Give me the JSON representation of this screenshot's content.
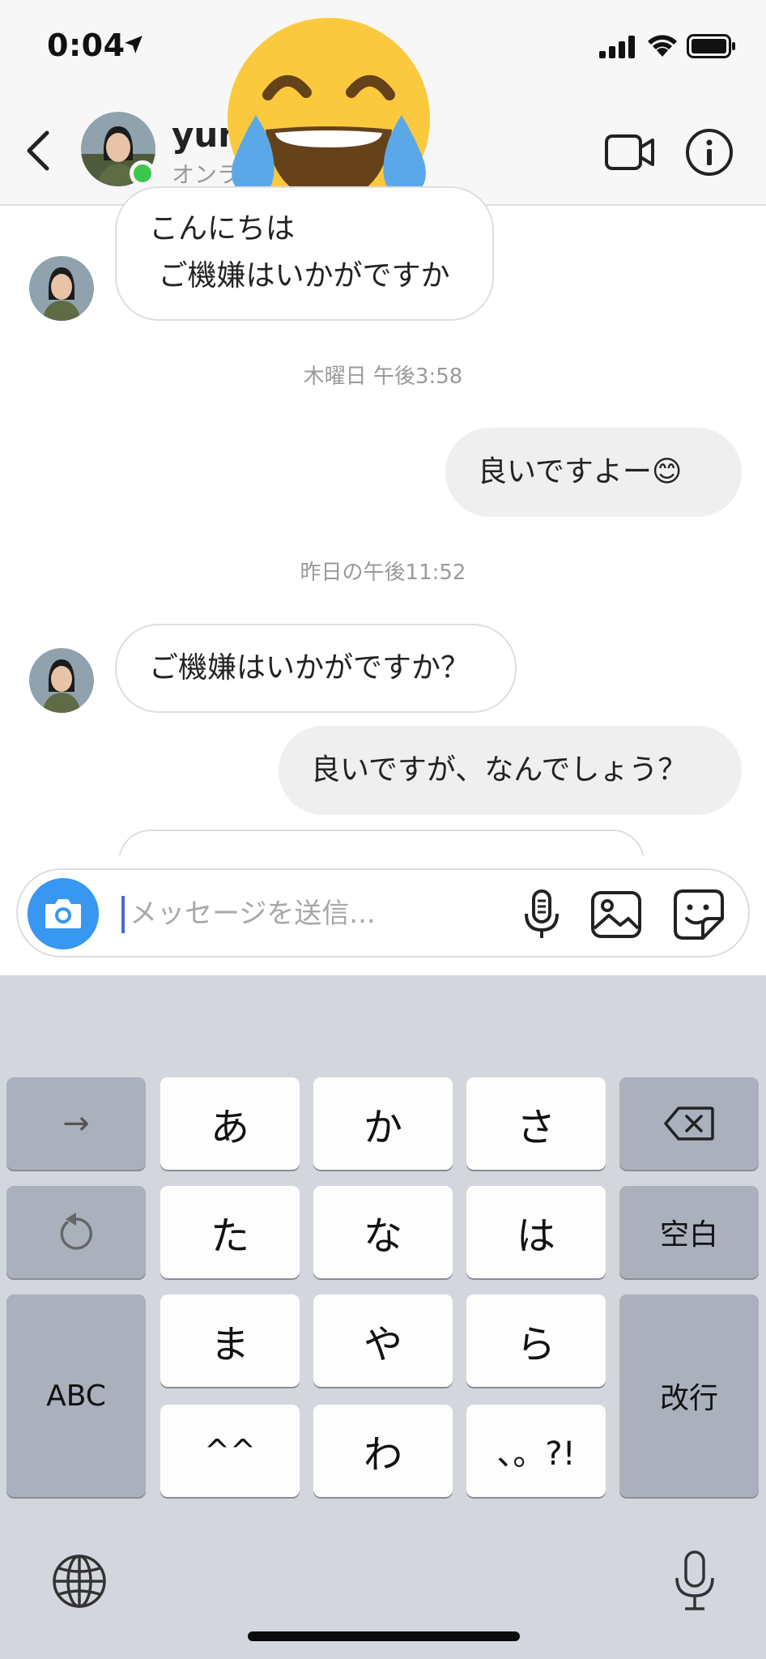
{
  "status_bar": {
    "time": "0:04"
  },
  "header": {
    "username": "yun",
    "status": "オンラ"
  },
  "messages": [
    {
      "side": "incoming",
      "text": "こんにちは\n ご機嫌はいかがですか"
    },
    {
      "side": "timestamp",
      "text": "木曜日 午後3:58"
    },
    {
      "side": "outgoing",
      "text": "良いですよー😊"
    },
    {
      "side": "timestamp",
      "text": "昨日の午後11:52"
    },
    {
      "side": "incoming",
      "text": "ご機嫌はいかがですか？"
    },
    {
      "side": "outgoing",
      "text": "良いですが、なんでしょう？"
    }
  ],
  "composer": {
    "placeholder": "メッセージを送信...",
    "value": ""
  },
  "keyboard": {
    "arrow_key": "→",
    "undo_key": "undo",
    "kana": [
      "あ",
      "か",
      "さ",
      "た",
      "な",
      "は",
      "ま",
      "や",
      "ら",
      "^^",
      "わ",
      "、。?!"
    ],
    "delete_key": "delete",
    "space_key": "空白",
    "abc_key": "ABC",
    "return_key": "改行"
  },
  "icons": {
    "back": "chevron-left-icon",
    "video": "video-camera-icon",
    "info": "info-icon",
    "camera": "camera-icon",
    "mic": "microphone-icon",
    "gallery": "image-icon",
    "sticker": "sticker-icon",
    "globe": "globe-icon"
  },
  "colors": {
    "online": "#3ac84a",
    "camera_button": "#3897f0",
    "caret": "#4a67d8",
    "keyboard_bg": "#d3d6dd",
    "key_dark": "#aab0bc"
  }
}
